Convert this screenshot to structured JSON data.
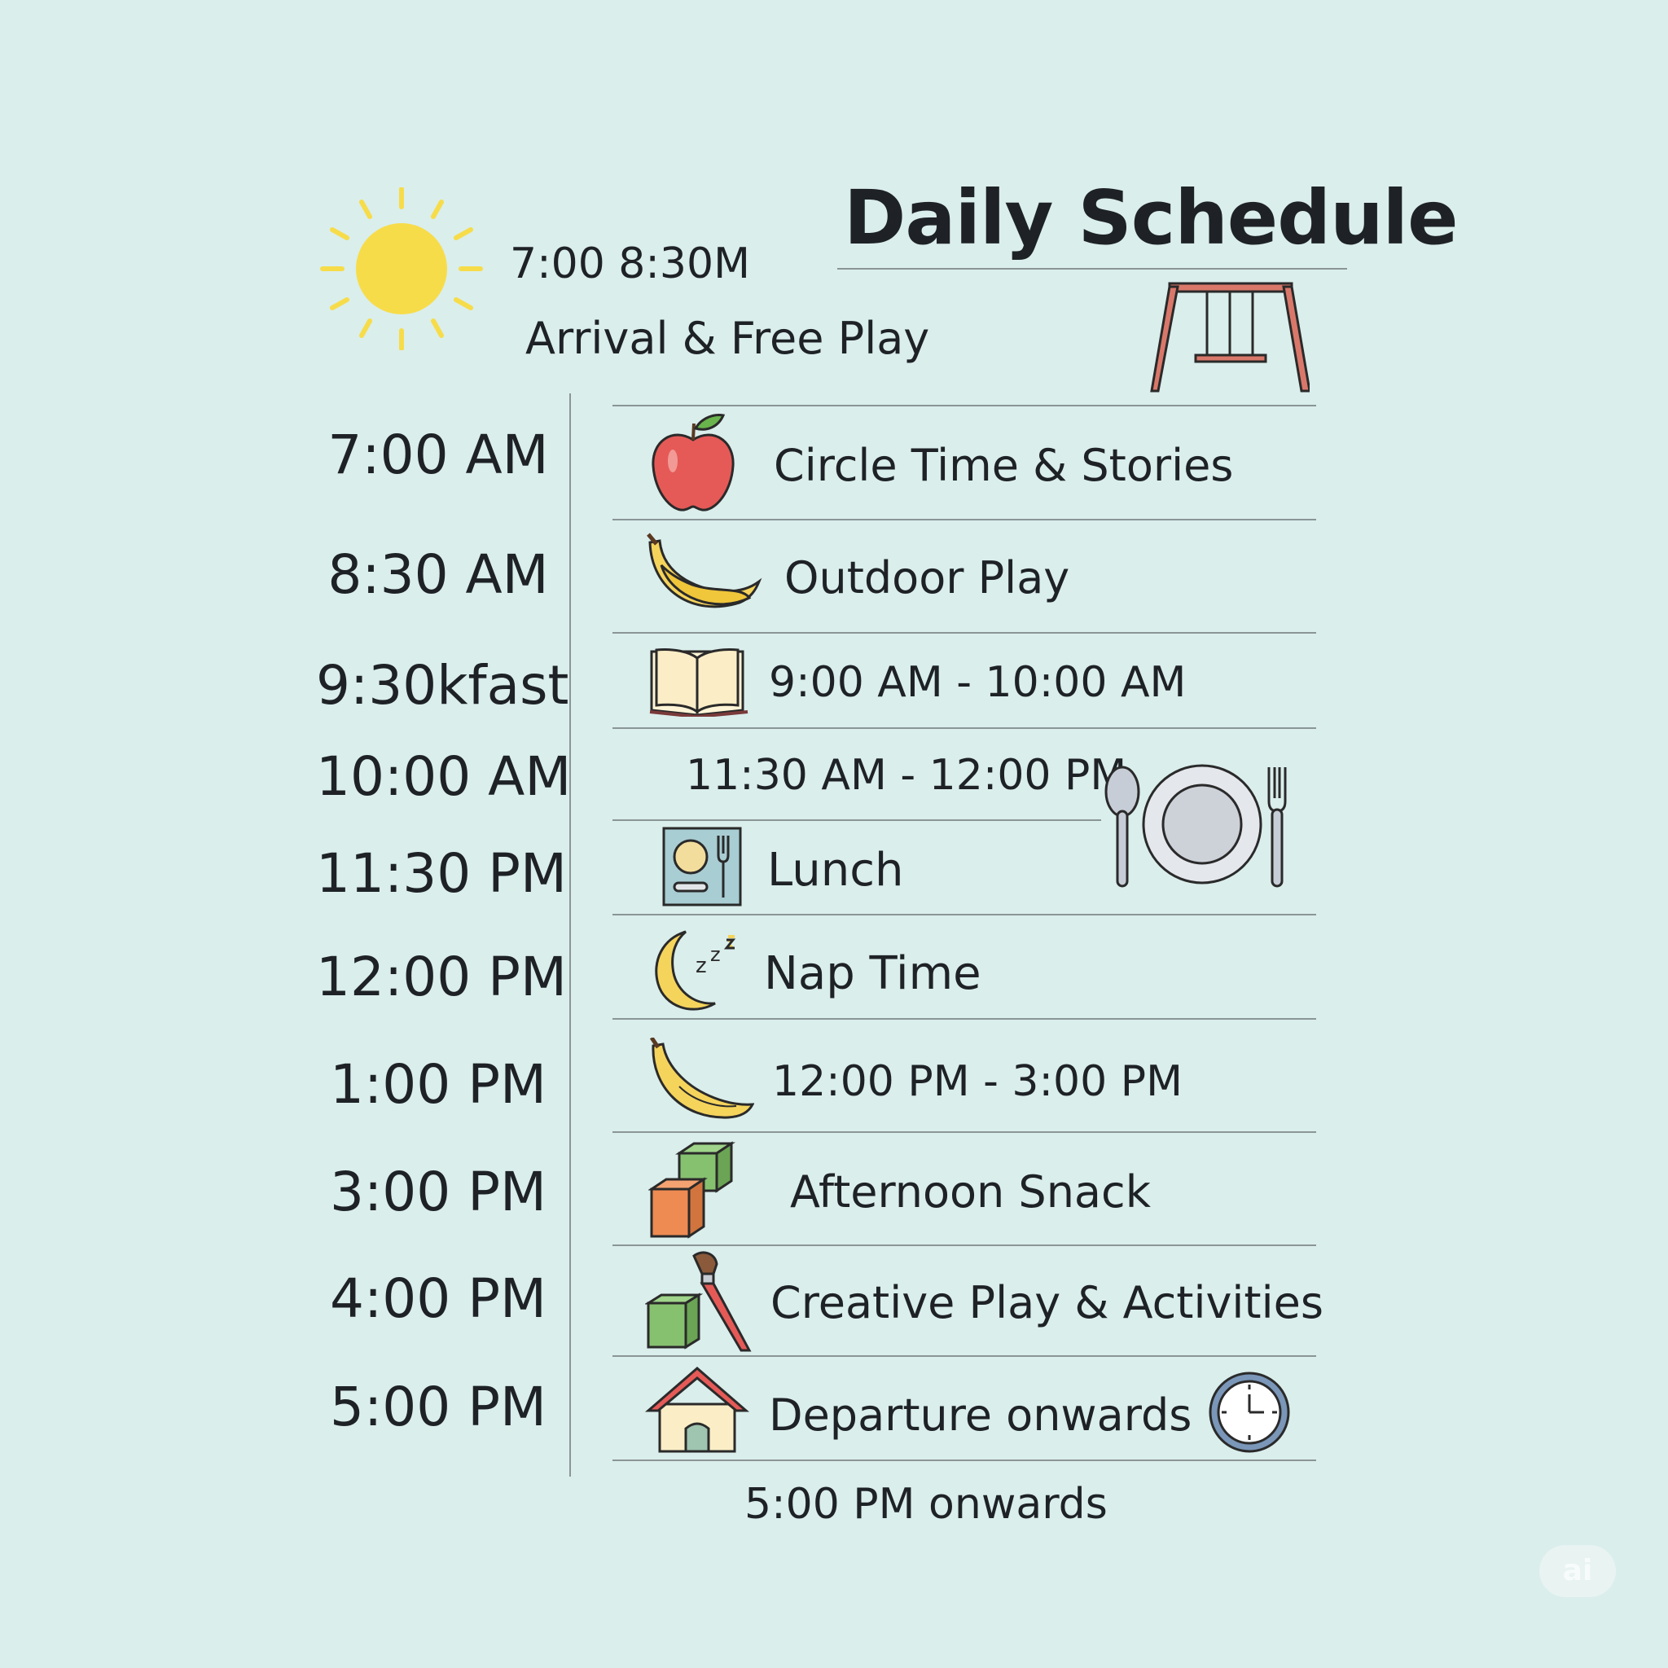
{
  "header": {
    "title": "Daily Schedule",
    "intro_time": "7:00 8:30M",
    "intro_label": "Arrival & Free Play"
  },
  "times": [
    "7:00 AM",
    "8:30 AM",
    "9:30kfast",
    "10:00 AM",
    "11:30 PM",
    "12:00 PM",
    "1:00 PM",
    "3:00 PM",
    "4:00 PM",
    "5:00 PM"
  ],
  "activities": [
    "Circle Time & Stories",
    "Outdoor Play",
    "9:00 AM - 10:00 AM",
    "11:30 AM - 12:00 PM",
    "Lunch",
    "Nap Time",
    "12:00 PM - 3:00 PM",
    "Afternoon Snack",
    "Creative Play & Activities",
    "Departure onwards"
  ],
  "icons": [
    "sun-icon",
    "swing-icon",
    "apple-icon",
    "banana-icon",
    "book-icon",
    "plate-cutlery-icon",
    "lunch-tray-icon",
    "moon-zzz-icon",
    "banana-icon",
    "blocks-icon",
    "blocks-paintbrush-icon",
    "house-icon",
    "clock-icon"
  ],
  "footer": "5:00 PM onwards",
  "badge": "ai",
  "colors": {
    "background": "#daeeec",
    "text": "#1e2226",
    "rule": "#8b9596",
    "sun": "#f7dc4a",
    "apple": "#e55a57",
    "banana": "#f5d45c",
    "swing": "#d9786a"
  }
}
